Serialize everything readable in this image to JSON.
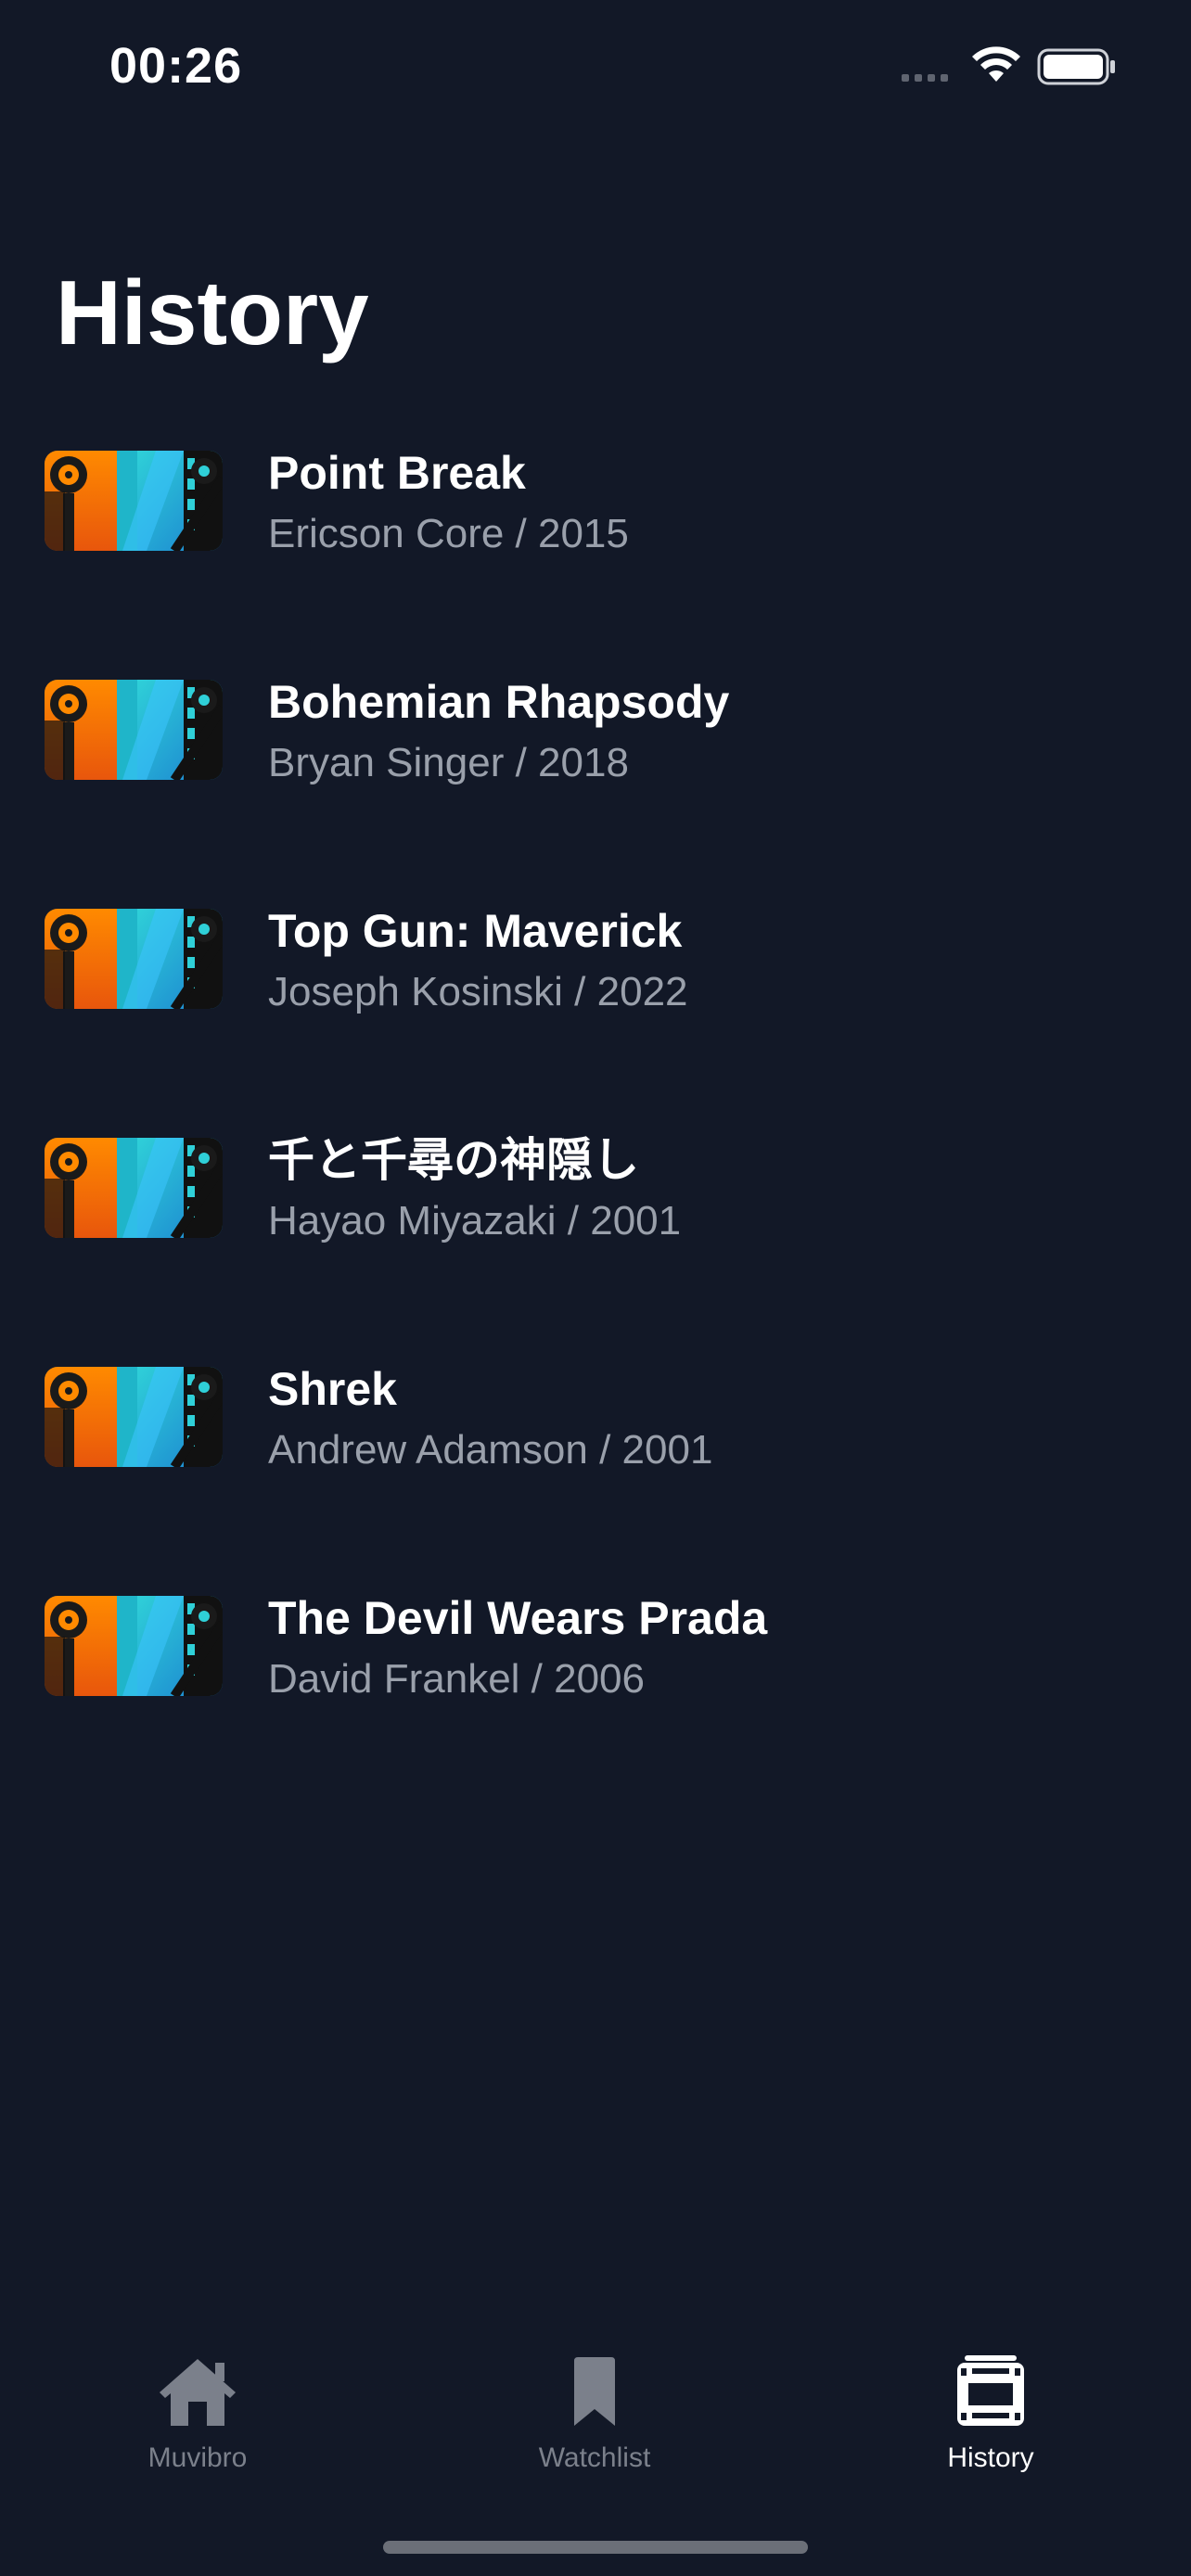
{
  "status_bar": {
    "time": "00:26",
    "signal_icon": "cellular-dots-icon",
    "wifi_icon": "wifi-icon",
    "battery_icon": "battery-full-icon"
  },
  "page": {
    "title": "History"
  },
  "movies": [
    {
      "title": "Point Break",
      "subtitle": "Ericson Core / 2015"
    },
    {
      "title": "Bohemian Rhapsody",
      "subtitle": "Bryan Singer / 2018"
    },
    {
      "title": "Top Gun: Maverick",
      "subtitle": "Joseph Kosinski / 2022"
    },
    {
      "title": "千と千尋の神隠し",
      "subtitle": "Hayao Miyazaki / 2001"
    },
    {
      "title": "Shrek",
      "subtitle": "Andrew Adamson / 2001"
    },
    {
      "title": "The Devil Wears Prada",
      "subtitle": "David Frankel / 2006"
    }
  ],
  "tab_bar": {
    "tabs": [
      {
        "label": "Muvibro",
        "icon": "home-icon",
        "active": false
      },
      {
        "label": "Watchlist",
        "icon": "bookmark-icon",
        "active": false
      },
      {
        "label": "History",
        "icon": "film-icon",
        "active": true
      }
    ]
  },
  "colors": {
    "background": "#121827",
    "text_primary": "#ffffff",
    "text_secondary": "#9aa0ab",
    "tab_inactive": "#7b808b"
  }
}
